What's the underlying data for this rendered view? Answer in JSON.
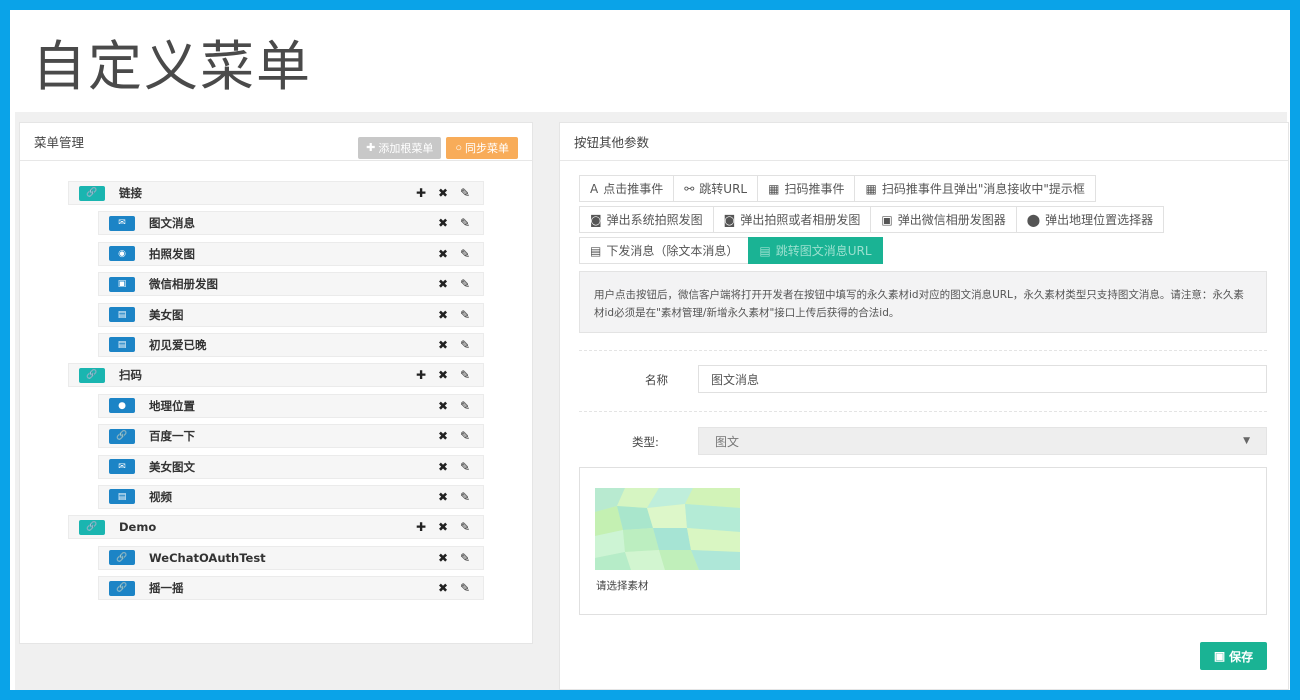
{
  "page_title": "自定义菜单",
  "left_panel": {
    "title": "菜单管理",
    "add_root_label": "添加根菜单",
    "sync_label": "同步菜单",
    "rows": [
      {
        "label": "链接",
        "level": "parent",
        "badge": "teal",
        "icon": "link-icon",
        "glyph": "🔗"
      },
      {
        "label": "图文消息",
        "level": "child",
        "badge": "blue",
        "icon": "envelope-icon",
        "glyph": "✉"
      },
      {
        "label": "拍照发图",
        "level": "child",
        "badge": "blue",
        "icon": "camera-icon",
        "glyph": "◉"
      },
      {
        "label": "微信相册发图",
        "level": "child",
        "badge": "blue",
        "icon": "image-icon",
        "glyph": "▣"
      },
      {
        "label": "美女图",
        "level": "child",
        "badge": "blue",
        "icon": "keyboard-icon",
        "glyph": "▤"
      },
      {
        "label": "初见爱已晚",
        "level": "child",
        "badge": "blue",
        "icon": "keyboard-icon",
        "glyph": "▤"
      },
      {
        "label": "扫码",
        "level": "parent",
        "badge": "teal",
        "icon": "link-icon",
        "glyph": "🔗"
      },
      {
        "label": "地理位置",
        "level": "child",
        "badge": "blue",
        "icon": "map-marker-icon",
        "glyph": "●"
      },
      {
        "label": "百度一下",
        "level": "child",
        "badge": "blue",
        "icon": "link-icon",
        "glyph": "🔗"
      },
      {
        "label": "美女图文",
        "level": "child",
        "badge": "blue",
        "icon": "envelope-icon",
        "glyph": "✉"
      },
      {
        "label": "视频",
        "level": "child",
        "badge": "blue",
        "icon": "keyboard-icon",
        "glyph": "▤"
      },
      {
        "label": "Demo",
        "level": "parent",
        "badge": "teal",
        "icon": "link-icon",
        "glyph": "🔗"
      },
      {
        "label": "WeChatOAuthTest",
        "level": "child",
        "badge": "blue",
        "icon": "link-icon",
        "glyph": "🔗"
      },
      {
        "label": "摇一摇",
        "level": "child",
        "badge": "blue",
        "icon": "link-icon",
        "glyph": "🔗"
      }
    ]
  },
  "right_panel": {
    "title": "按钮其他参数",
    "tab_lines": [
      [
        {
          "label": "点击推事件",
          "icon": "font-icon",
          "glyph": "A",
          "active": false
        },
        {
          "label": "跳转URL",
          "icon": "link-icon",
          "glyph": "⚯",
          "active": false
        },
        {
          "label": "扫码推事件",
          "icon": "qrcode-icon",
          "glyph": "▦",
          "active": false
        },
        {
          "label": "扫码推事件且弹出\"消息接收中\"提示框",
          "icon": "qrcode-icon",
          "glyph": "▦",
          "active": false
        }
      ],
      [
        {
          "label": "弹出系统拍照发图",
          "icon": "camera-icon",
          "glyph": "◙",
          "active": false
        },
        {
          "label": "弹出拍照或者相册发图",
          "icon": "camera-icon",
          "glyph": "◙",
          "active": false
        },
        {
          "label": "弹出微信相册发图器",
          "icon": "image-icon",
          "glyph": "▣",
          "active": false
        },
        {
          "label": "弹出地理位置选择器",
          "icon": "map-marker-icon",
          "glyph": "⬤",
          "active": false
        }
      ],
      [
        {
          "label": "下发消息（除文本消息）",
          "icon": "keyboard-icon",
          "glyph": "▤",
          "active": false
        },
        {
          "label": "跳转图文消息URL",
          "icon": "keyboard-icon",
          "glyph": "▤",
          "active": true
        }
      ]
    ],
    "description": "用户点击按钮后，微信客户端将打开开发者在按钮中填写的永久素材id对应的图文消息URL，永久素材类型只支持图文消息。请注意：永久素材id必须是在\"素材管理/新增永久素材\"接口上传后获得的合法id。",
    "name_label": "名称",
    "name_value": "图文消息",
    "type_label": "类型:",
    "type_value": "图文",
    "material_caption": "请选择素材",
    "save_label": "保存"
  }
}
